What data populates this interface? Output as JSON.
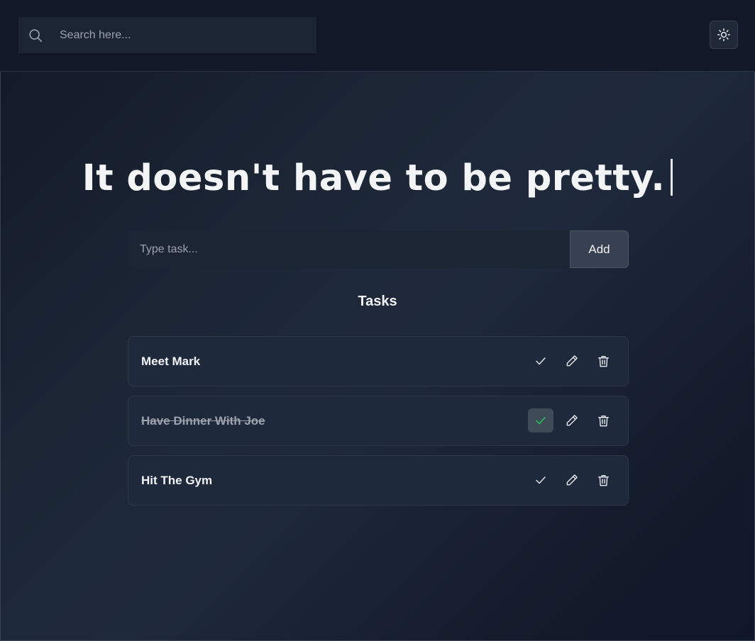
{
  "search": {
    "placeholder": "Search here..."
  },
  "headline": "It doesn't have to be pretty.",
  "task_form": {
    "placeholder": "Type task...",
    "add_label": "Add"
  },
  "tasks_heading": "Tasks",
  "tasks": [
    {
      "label": "Meet Mark",
      "completed": false
    },
    {
      "label": "Have Dinner With Joe",
      "completed": true
    },
    {
      "label": "Hit The Gym",
      "completed": false
    }
  ],
  "icons": {
    "search": "search-icon",
    "theme": "sun-icon",
    "complete": "check-icon",
    "edit": "pencil-icon",
    "delete": "trash-icon"
  },
  "colors": {
    "check_active": "#22c55e",
    "check_default": "#e5e7eb"
  }
}
